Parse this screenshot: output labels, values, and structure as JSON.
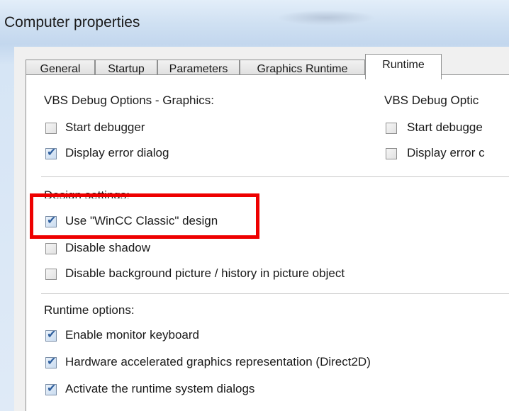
{
  "window": {
    "title": "Computer properties"
  },
  "tabs": [
    {
      "label": "General",
      "active": false
    },
    {
      "label": "Startup",
      "active": false
    },
    {
      "label": "Parameters",
      "active": false
    },
    {
      "label": "Graphics Runtime",
      "active": false
    },
    {
      "label": "Runtime",
      "active": true
    }
  ],
  "vbs_graphics": {
    "heading": "VBS Debug Options - Graphics:",
    "start_debugger": {
      "label": "Start debugger",
      "checked": false
    },
    "display_error_dialog": {
      "label": "Display error dialog",
      "checked": true
    }
  },
  "vbs_other": {
    "heading": "VBS Debug Optic",
    "start_debugger": {
      "label": "Start debugge",
      "checked": false
    },
    "display_error_dialog": {
      "label": "Display error c",
      "checked": false
    }
  },
  "design": {
    "heading": "Design settings:",
    "use_classic": {
      "label": "Use \"WinCC Classic\" design",
      "checked": true
    },
    "disable_shadow": {
      "label": "Disable shadow",
      "checked": false
    },
    "disable_background": {
      "label": "Disable background picture / history in picture object",
      "checked": false
    }
  },
  "runtime_options": {
    "heading": "Runtime options:",
    "monitor_keyboard": {
      "label": "Enable monitor keyboard",
      "checked": true
    },
    "hw_accel": {
      "label": "Hardware accelerated graphics representation (Direct2D)",
      "checked": true
    },
    "system_dialogs": {
      "label": "Activate the runtime system dialogs",
      "checked": true
    }
  },
  "colors": {
    "highlight": "#ee0000",
    "check_mark": "#2f5f9e"
  }
}
